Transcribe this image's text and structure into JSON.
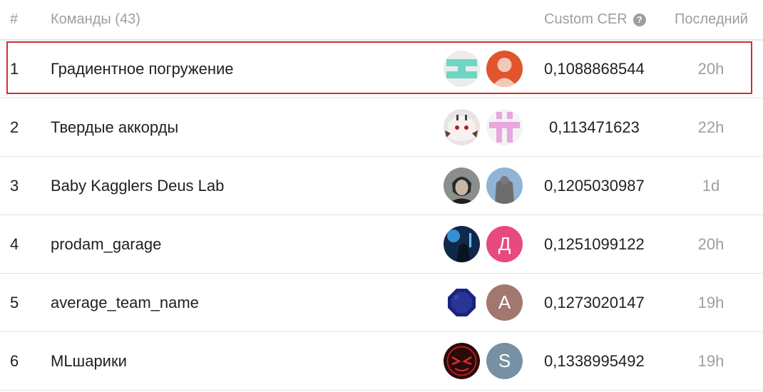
{
  "header": {
    "rank": "#",
    "team": "Команды (43)",
    "score": "Custom CER",
    "help_icon": "?",
    "last": "Последний"
  },
  "rows": [
    {
      "rank": "1",
      "team": "Градиентное погружение",
      "score": "0,1088868544",
      "last": "20h",
      "highlighted": true
    },
    {
      "rank": "2",
      "team": "Твердые аккорды",
      "score": "0,113471623",
      "last": "22h"
    },
    {
      "rank": "3",
      "team": "Baby Kagglers Deus Lab",
      "score": "0,1205030987",
      "last": "1d"
    },
    {
      "rank": "4",
      "team": "prodam_garage",
      "score": "0,1251099122",
      "last": "20h"
    },
    {
      "rank": "5",
      "team": "average_team_name",
      "score": "0,1273020147",
      "last": "19h"
    },
    {
      "rank": "6",
      "team": "MLшарики",
      "score": "0,1338995492",
      "last": "19h"
    }
  ],
  "avatars": {
    "row4_member2_letter": "Д",
    "row5_member2_letter": "A",
    "row6_member2_letter": "S"
  },
  "colors": {
    "highlight_border": "#d32f2f",
    "header_text": "#9e9e9e",
    "body_text": "#202124"
  }
}
